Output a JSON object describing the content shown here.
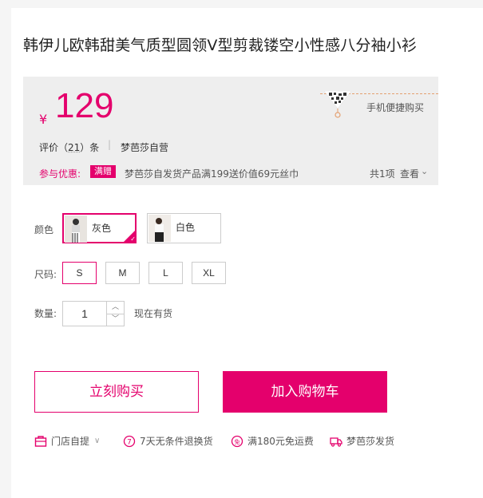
{
  "product": {
    "title": "韩伊儿欧韩甜美气质型圆领V型剪裁镂空小性感八分袖小衫"
  },
  "price_box": {
    "currency": "¥",
    "price": "129",
    "review_prefix": "评价（",
    "review_count": "21",
    "review_suffix": "）条",
    "separator": "|",
    "store": "梦芭莎自营",
    "mobile_buy": "手机便捷购买",
    "promo_label": "参与优惠:",
    "promo_badge": "满赠",
    "promo_text": "梦芭莎自发货产品满199送价值69元丝巾",
    "promo_count": "共1项",
    "promo_view": "查看"
  },
  "color": {
    "label": "颜色",
    "options": [
      {
        "label": "灰色",
        "selected": true
      },
      {
        "label": "白色",
        "selected": false
      }
    ]
  },
  "size": {
    "label": "尺码:",
    "options": [
      "S",
      "M",
      "L",
      "XL"
    ],
    "selected": "S"
  },
  "quantity": {
    "label": "数量:",
    "value": "1",
    "stock_text": "现在有货"
  },
  "actions": {
    "buy_now": "立刻购买",
    "add_to_cart": "加入购物车"
  },
  "services": [
    {
      "label": "门店自提",
      "icon": "store-icon"
    },
    {
      "label": "7天无条件退换货",
      "icon": "return-icon"
    },
    {
      "label": "满180元免运费",
      "icon": "free-shipping-icon"
    },
    {
      "label": "梦芭莎发货",
      "icon": "truck-icon"
    }
  ],
  "colors": {
    "accent": "#e4006c",
    "panel": "#eeeeee"
  }
}
